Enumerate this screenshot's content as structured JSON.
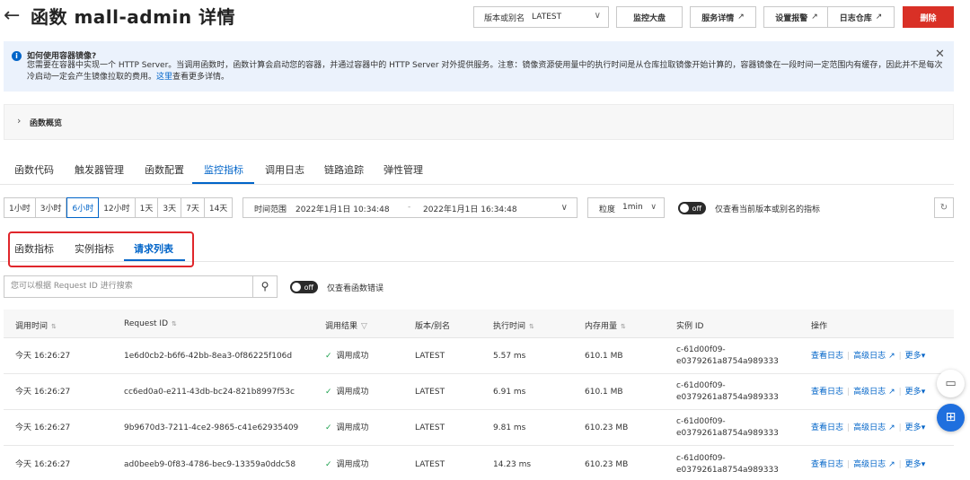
{
  "header": {
    "back_icon": "arrow-left-icon",
    "title": "函数 mall-admin 详情",
    "version_select": {
      "label": "版本或别名",
      "value": "LATEST"
    },
    "buttons": {
      "dashboard": "监控大盘",
      "service_detail": "服务详情",
      "alarm": "设置报警",
      "log_repo": "日志仓库",
      "delete": "删除"
    }
  },
  "banner": {
    "title": "如何使用容器镜像?",
    "text": "您需要在容器中实现一个 HTTP Server。当调用函数时，函数计算会启动您的容器，并通过容器中的 HTTP Server 对外提供服务。注意：镜像资源使用量中的执行时间是从仓库拉取镜像开始计算的，容器镜像在一段时间一定范围内有缓存，因此并不是每次冷启动一定会产生镜像拉取的费用。",
    "link": "这里",
    "link_suffix": "查看更多详情。"
  },
  "overview": {
    "label": "函数概览"
  },
  "main_tabs": [
    "函数代码",
    "触发器管理",
    "函数配置",
    "监控指标",
    "调用日志",
    "链路追踪",
    "弹性管理"
  ],
  "time_buttons": [
    "1小时",
    "3小时",
    "6小时",
    "12小时",
    "1天",
    "3天",
    "7天",
    "14天"
  ],
  "time_range": {
    "label": "时间范围",
    "start": "2022年1月1日 10:34:48",
    "dash": "-",
    "end": "2022年1月1日 16:34:48"
  },
  "granularity": {
    "label": "粒度",
    "value": "1min"
  },
  "version_toggle": {
    "state": "off",
    "label": "仅查看当前版本或别名的指标"
  },
  "sub_tabs": [
    "函数指标",
    "实例指标",
    "请求列表"
  ],
  "search": {
    "placeholder": "您可以根据 Request ID 进行搜索"
  },
  "error_toggle": {
    "state": "off",
    "label": "仅查看函数错误"
  },
  "table": {
    "headers": {
      "time": "调用时间",
      "request_id": "Request ID",
      "result": "调用结果",
      "version": "版本/别名",
      "duration": "执行时间",
      "memory": "内存用量",
      "instance": "实例 ID",
      "actions": "操作"
    },
    "rows": [
      {
        "time": "今天 16:26:27",
        "request_id": "1e6d0cb2-b6f6-42bb-8ea3-0f86225f106d",
        "result": "调用成功",
        "version": "LATEST",
        "duration": "5.57 ms",
        "memory": "610.1 MB",
        "instance_a": "c-61d00f09-",
        "instance_b": "e0379261a8754a989333"
      },
      {
        "time": "今天 16:26:27",
        "request_id": "cc6ed0a0-e211-43db-bc24-821b8997f53c",
        "result": "调用成功",
        "version": "LATEST",
        "duration": "6.91 ms",
        "memory": "610.1 MB",
        "instance_a": "c-61d00f09-",
        "instance_b": "e0379261a8754a989333"
      },
      {
        "time": "今天 16:26:27",
        "request_id": "9b9670d3-7211-4ce2-9865-c41e62935409",
        "result": "调用成功",
        "version": "LATEST",
        "duration": "9.81 ms",
        "memory": "610.23 MB",
        "instance_a": "c-61d00f09-",
        "instance_b": "e0379261a8754a989333"
      },
      {
        "time": "今天 16:26:27",
        "request_id": "ad0beeb9-0f83-4786-bec9-13359a0ddc58",
        "result": "调用成功",
        "version": "LATEST",
        "duration": "14.23 ms",
        "memory": "610.23 MB",
        "instance_a": "c-61d00f09-",
        "instance_b": "e0379261a8754a989333"
      }
    ],
    "actions": {
      "view_log": "查看日志",
      "advanced_log": "高级日志",
      "more": "更多"
    }
  },
  "colors": {
    "accent": "#0064c8",
    "danger": "#d93026",
    "success": "#1ba04c",
    "highlight": "#e0262b"
  }
}
